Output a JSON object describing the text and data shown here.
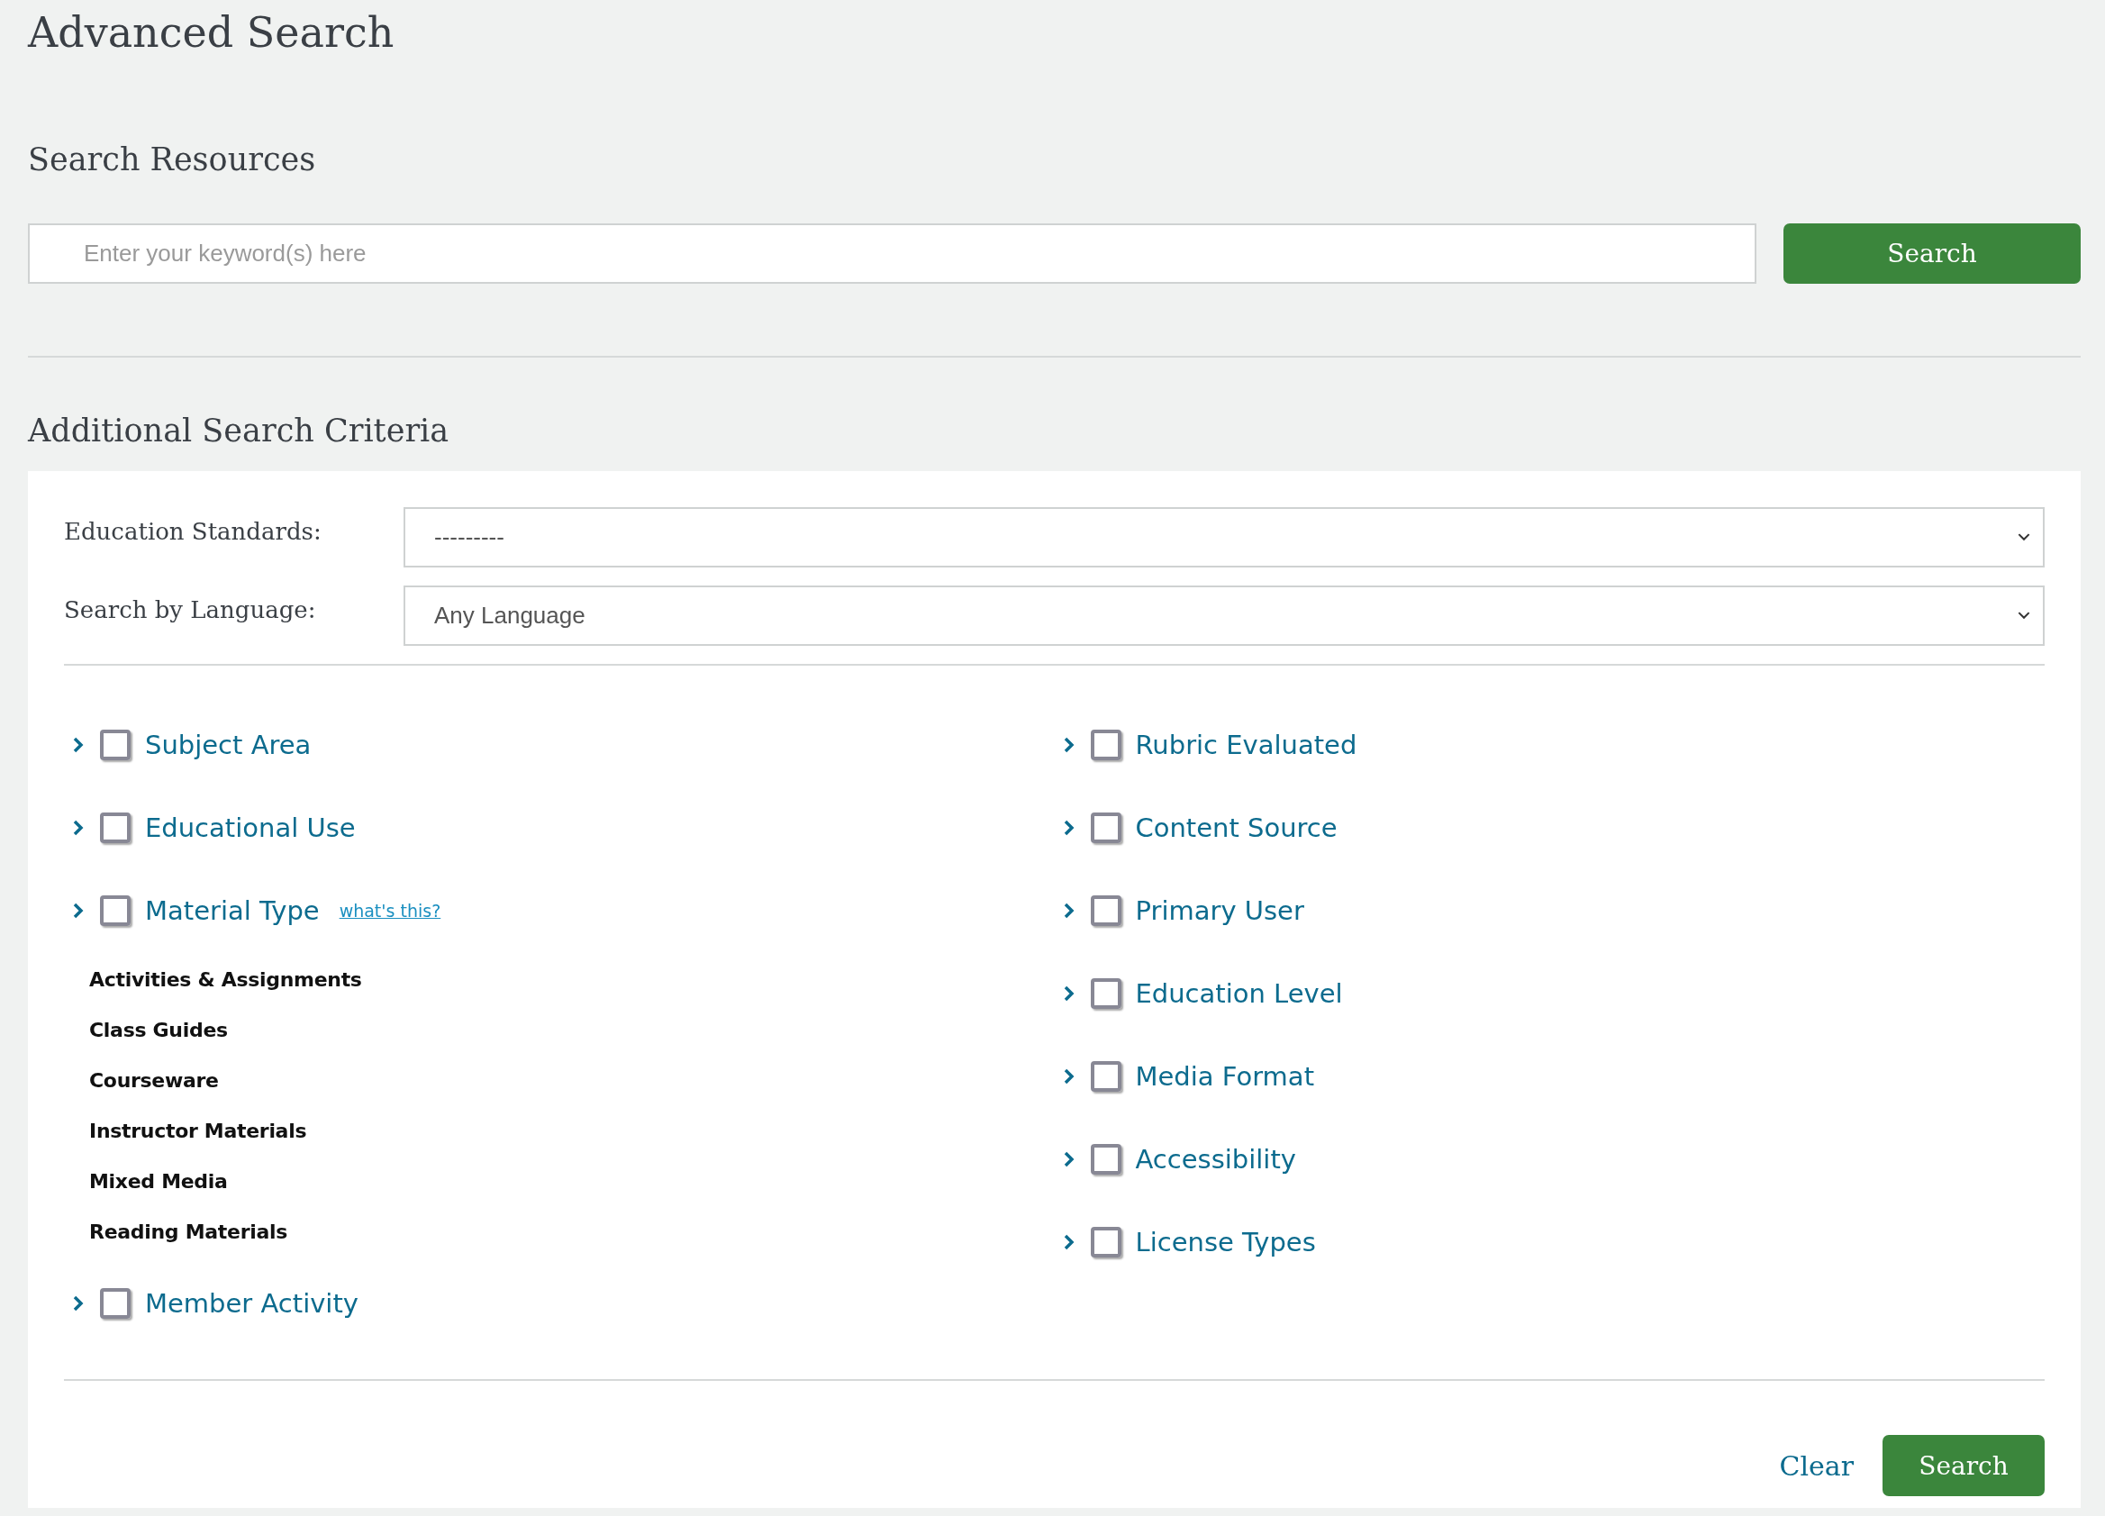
{
  "page_title": "Advanced Search",
  "search_section": {
    "heading": "Search Resources",
    "placeholder": "Enter your keyword(s) here",
    "button": "Search"
  },
  "criteria": {
    "heading": "Additional Search Criteria",
    "selects": [
      {
        "label": "Education Standards:",
        "value": "---------"
      },
      {
        "label": "Search by Language:",
        "value": "Any Language"
      }
    ],
    "columns": [
      [
        {
          "label": "Subject Area",
          "checked": false
        },
        {
          "label": "Educational Use",
          "checked": false
        },
        {
          "label": "Material Type",
          "checked": false,
          "help_link": "what's this?",
          "children": [
            "Activities & Assignments",
            "Class Guides",
            "Courseware",
            "Instructor Materials",
            "Mixed Media",
            "Reading Materials"
          ]
        },
        {
          "label": "Member Activity",
          "checked": false
        }
      ],
      [
        {
          "label": "Rubric Evaluated",
          "checked": false
        },
        {
          "label": "Content Source",
          "checked": false
        },
        {
          "label": "Primary User",
          "checked": false
        },
        {
          "label": "Education Level",
          "checked": false
        },
        {
          "label": "Media Format",
          "checked": false
        },
        {
          "label": "Accessibility",
          "checked": false
        },
        {
          "label": "License Types",
          "checked": false
        }
      ]
    ],
    "clear": "Clear",
    "button": "Search"
  }
}
